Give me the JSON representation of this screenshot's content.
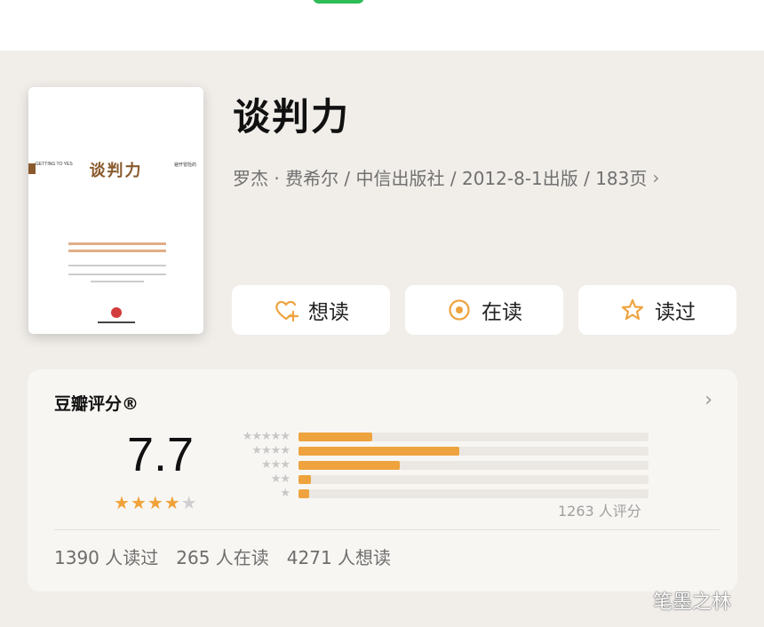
{
  "book": {
    "title": "谈判力",
    "meta": "罗杰 · 费希尔 / 中信出版社 / 2012-8-1出版 / 183页",
    "cover": {
      "title": "谈判力",
      "left_text": "GETTING TO YES",
      "right_text": "避开冒险的"
    }
  },
  "actions": {
    "want": "想读",
    "reading": "在读",
    "read": "读过"
  },
  "rating": {
    "heading": "豆瓣评分®",
    "score": "7.7",
    "stars_filled": 4,
    "stars_total": 5,
    "distribution": [
      {
        "stars": "★★★★★",
        "value": 0.21
      },
      {
        "stars": "★★★★",
        "value": 0.46
      },
      {
        "stars": "★★★",
        "value": 0.29
      },
      {
        "stars": "★★",
        "value": 0.035
      },
      {
        "stars": "★",
        "value": 0.03
      }
    ],
    "count_text": "1263 人评分"
  },
  "stats": {
    "read": "1390 人读过",
    "reading": "265 人在读",
    "want": "4271 人想读"
  },
  "watermark": "笔墨之林",
  "colors": {
    "accent": "#eea33f",
    "background": "#f1eeea"
  },
  "icons": {
    "want": "heart-plus-icon",
    "reading": "target-circle-icon",
    "read": "star-outline-icon"
  }
}
